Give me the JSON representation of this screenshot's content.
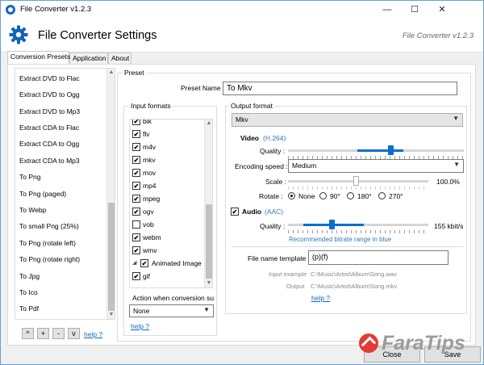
{
  "window": {
    "title": "File Converter v1.2.3",
    "minimize": "—",
    "maximize": "☐",
    "close": "✕"
  },
  "header": {
    "title": "File Converter Settings",
    "version": "File Converter v1.2.3",
    "icon": "gear-icon"
  },
  "tabs": [
    {
      "label": "Conversion Presets",
      "active": true
    },
    {
      "label": "Application",
      "active": false
    },
    {
      "label": "About",
      "active": false
    }
  ],
  "presets": {
    "items": [
      "Extract DVD to Flac",
      "Extract DVD to Ogg",
      "Extract DVD to Mp3",
      "Extract CDA to Flac",
      "Extract CDA to Ogg",
      "Extract CDA to Mp3",
      "To Png",
      "To Png (paged)",
      "To Webp",
      "To small Png (25%)",
      "To Png (rotate left)",
      "To Png (rotate right)",
      "To Jpg",
      "To Ico",
      "To Pdf"
    ],
    "buttons": [
      "^",
      "+",
      "-",
      "v"
    ],
    "help_label": "help ?"
  },
  "preset": {
    "group_title": "Preset",
    "name_label": "Preset Name",
    "name_value": "To Mkv"
  },
  "input_formats": {
    "group_title": "Input formats",
    "items": [
      {
        "label": "bik",
        "checked": true
      },
      {
        "label": "flv",
        "checked": true
      },
      {
        "label": "m4v",
        "checked": true
      },
      {
        "label": "mkv",
        "checked": true
      },
      {
        "label": "mov",
        "checked": true
      },
      {
        "label": "mp4",
        "checked": true
      },
      {
        "label": "mpeg",
        "checked": true
      },
      {
        "label": "ogv",
        "checked": true
      },
      {
        "label": "vob",
        "checked": false
      },
      {
        "label": "webm",
        "checked": true
      },
      {
        "label": "wmv",
        "checked": true
      }
    ],
    "category": {
      "label": "Animated Image",
      "checked": true,
      "expander": "◢"
    },
    "category_items": [
      {
        "label": "gif",
        "checked": true
      }
    ],
    "action_label": "Action when conversion su",
    "action_value": "None",
    "help_label": "help ?"
  },
  "output": {
    "group_title": "Output format",
    "format_value": "Mkv",
    "video": {
      "title": "Video",
      "codec": "(H.264)",
      "quality_label": "Quality :",
      "encoding_speed_label": "Encoding speed :",
      "encoding_speed_value": "Medium",
      "scale_label": "Scale :",
      "scale_value": "100.0%",
      "rotate_label": "Rotate :",
      "rotate_options": [
        "None",
        "90°",
        "180°",
        "270°"
      ],
      "rotate_selected": 0
    },
    "audio": {
      "title": "Audio",
      "codec": "(AAC)",
      "enabled": true,
      "quality_label": "Quality :",
      "quality_value": "155 kbit/s",
      "recommend": "Recommended bitrate range in blue"
    },
    "template": {
      "label": "File name template",
      "value": "(p)(f)",
      "input_example_label": "Input example",
      "input_example_value": "C:\\Music\\Artist\\Album\\Song.wav",
      "output_label": "Output",
      "output_value": "C:\\Music\\Artist\\Album\\Song.mkv",
      "help_label": "help ?"
    }
  },
  "footer": {
    "close_label": "Close",
    "save_label": "Save"
  },
  "watermark": {
    "text": "FaraTips"
  }
}
